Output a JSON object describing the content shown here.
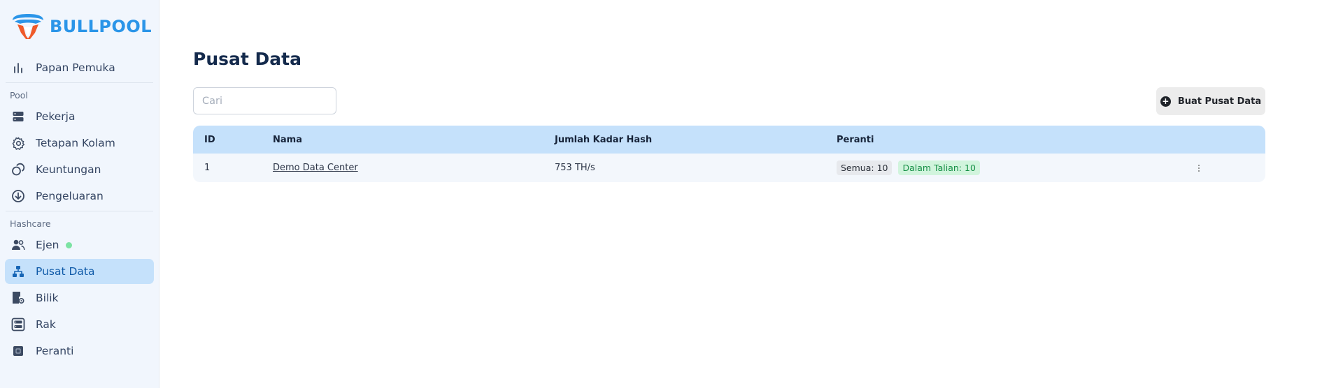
{
  "brand": {
    "name": "BULLPOOL",
    "accent": "#2b95e8"
  },
  "sidebar": {
    "top_items": [
      {
        "label": "Papan Pemuka",
        "icon": "bar-chart-icon"
      }
    ],
    "sections": [
      {
        "label": "Pool",
        "items": [
          {
            "label": "Pekerja",
            "icon": "server-icon"
          },
          {
            "label": "Tetapan Kolam",
            "icon": "gear-icon"
          },
          {
            "label": "Keuntungan",
            "icon": "coins-icon"
          },
          {
            "label": "Pengeluaran",
            "icon": "download-circle-icon"
          }
        ]
      },
      {
        "label": "Hashcare",
        "items": [
          {
            "label": "Ejen",
            "icon": "users-icon",
            "status": "online"
          },
          {
            "label": "Pusat Data",
            "icon": "sitemap-icon",
            "active": true
          },
          {
            "label": "Bilik",
            "icon": "room-gear-icon"
          },
          {
            "label": "Rak",
            "icon": "rack-icon"
          },
          {
            "label": "Peranti",
            "icon": "chip-icon"
          }
        ]
      }
    ]
  },
  "main": {
    "title": "Pusat Data",
    "search": {
      "placeholder": "Cari",
      "value": ""
    },
    "create_button": "Buat Pusat Data",
    "table": {
      "columns": [
        "ID",
        "Nama",
        "Jumlah Kadar Hash",
        "Peranti"
      ],
      "rows": [
        {
          "id": "1",
          "name": "Demo Data Center",
          "hashrate": "753 TH/s",
          "devices_all": "Semua: 10",
          "devices_online": "Dalam Talian: 10"
        }
      ]
    }
  }
}
